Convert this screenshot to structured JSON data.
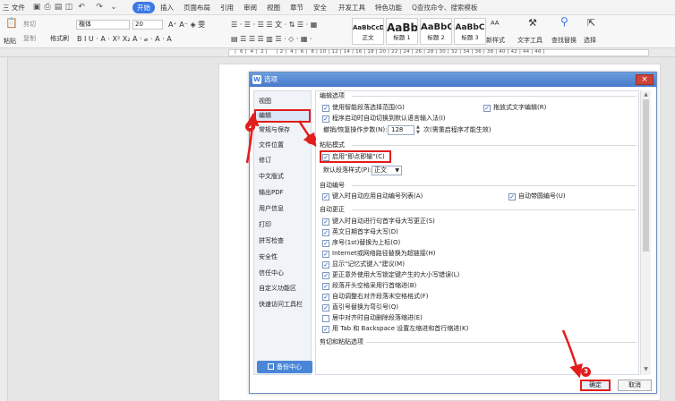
{
  "menubar": {
    "file_label": "三 文件",
    "tabs": [
      "开始",
      "插入",
      "页面布局",
      "引用",
      "审阅",
      "视图",
      "章节",
      "安全",
      "开发工具",
      "特色功能"
    ],
    "search_label": "Q查找命令、搜索模板"
  },
  "ribbon": {
    "cut_label": "剪切",
    "paste_label": "粘贴",
    "copy_label": "复制",
    "format_painter_label": "格式刷",
    "font_name": "楷体",
    "font_size": "20",
    "styles": [
      {
        "preview": "AaBbCcDd",
        "label": "正文",
        "size": "7px"
      },
      {
        "preview": "AaBb",
        "label": "标题 1",
        "size": "13px"
      },
      {
        "preview": "AaBbC",
        "label": "标题 2",
        "size": "11px"
      },
      {
        "preview": "AaBbC",
        "label": "标题 3",
        "size": "10px"
      }
    ],
    "new_style_label": "新样式",
    "text_tool_label": "文字工具",
    "find_replace_label": "查找替换",
    "select_label": "选择"
  },
  "ruler": {
    "numbers": "|  6 |  4 |  2 |     | 2 |  4 |  6 |  8 | 10 | 12 | 14 | 16 | 18 | 20 | 22 | 24 | 26 | 28 | 30 | 32 | 34 | 36 | 38 | 40 | 42 | 44 | 46 |"
  },
  "dialog": {
    "title": "选项",
    "nav_items": [
      "视图",
      "编辑",
      "常规与保存",
      "文件位置",
      "修订",
      "中文版式",
      "输出PDF",
      "用户信息",
      "打印",
      "拼写检查",
      "安全性",
      "信任中心",
      "自定义功能区",
      "快速访问工具栏"
    ],
    "selected_nav": "编辑",
    "backup_label": "备份中心",
    "sections": {
      "edit": {
        "title": "编辑选项",
        "options": [
          {
            "label": "使用智能段落选择范围(G)",
            "checked": true
          },
          {
            "label": "拖放式文字编辑(R)",
            "checked": true
          },
          {
            "label": "程序启动时自动切换到默认语言输入法(I)",
            "checked": true
          }
        ],
        "undo_label": "撤销/恢复操作步数(N):",
        "undo_value": "128",
        "undo_note": "次(需重启程序才能生效)"
      },
      "paste_mode": {
        "title": "粘贴模式",
        "enable_label": "启用\"即点即输\"(C)",
        "enable_checked": true,
        "default_style_label": "默认段落样式(P):",
        "default_style_value": "正文"
      },
      "autonumber": {
        "title": "自动编号",
        "options": [
          {
            "label": "键入时自动应用自动编号列表(A)",
            "checked": true
          },
          {
            "label": "自动带圆编号(U)",
            "checked": true
          }
        ]
      },
      "autocorrect": {
        "title": "自动更正",
        "options": [
          {
            "label": "键入时自动进行句首字母大写更正(S)",
            "checked": true
          },
          {
            "label": "英文日期首字母大写(D)",
            "checked": true
          },
          {
            "label": "序号(1st)替换为上标(O)",
            "checked": true
          },
          {
            "label": "Internet或网络路径替换为超链接(H)",
            "checked": true
          },
          {
            "label": "显示\"记忆式键入\"建议(M)",
            "checked": true
          },
          {
            "label": "更正意外使用大写锁定键产生的大小写错误(L)",
            "checked": true
          },
          {
            "label": "段落开头空格采用行首缩进(B)",
            "checked": true
          },
          {
            "label": "自动调整右对齐段落末空格格式(F)",
            "checked": true
          },
          {
            "label": "直引号替换为弯引号(Q)",
            "checked": true
          },
          {
            "label": "居中对齐时自动删除段落缩进(E)",
            "checked": false
          },
          {
            "label": "用 Tab 和 Backspace 设置左缩进和首行缩进(K)",
            "checked": true
          }
        ]
      },
      "cut_paste": {
        "title": "剪切和粘贴选项"
      }
    },
    "ok_label": "确定",
    "cancel_label": "取消",
    "badges": [
      "1",
      "2",
      "3"
    ]
  },
  "colors": {
    "accent": "#3a78e6",
    "annotation": "#e21d1d"
  }
}
